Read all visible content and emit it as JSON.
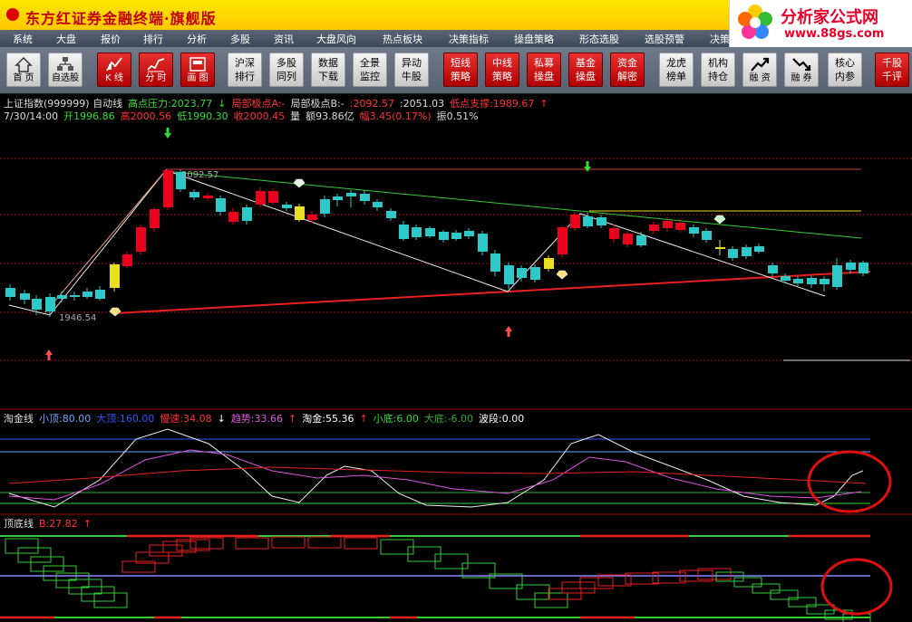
{
  "app": {
    "title": "东方红证券金融终端·旗舰版",
    "brand_name": "分析家公式网",
    "brand_url": "www.88gs.com"
  },
  "menu": [
    "系统",
    "大盘",
    "报价",
    "排行",
    "分析",
    "多股",
    "资讯",
    "大盘风向",
    "热点板块",
    "决策指标",
    "操盘策略",
    "形态选股",
    "选股预警",
    "决策"
  ],
  "toolbar": [
    {
      "label": "首 页",
      "style": "grey",
      "icon": "home-icon"
    },
    {
      "label": "自选股",
      "style": "grey",
      "icon": "portfolio-icon"
    },
    {
      "label": "K 线",
      "style": "red",
      "icon": "kline-icon"
    },
    {
      "label": "分 时",
      "style": "red",
      "icon": "timeshare-icon"
    },
    {
      "label": "画 图",
      "style": "red",
      "icon": "draw-icon"
    },
    {
      "label": "沪深\n排行",
      "style": "grey"
    },
    {
      "label": "多股\n同列",
      "style": "grey"
    },
    {
      "label": "数据\n下载",
      "style": "grey"
    },
    {
      "label": "全景\n监控",
      "style": "grey"
    },
    {
      "label": "异动\n牛股",
      "style": "grey"
    },
    {
      "label": "短线\n策略",
      "style": "red"
    },
    {
      "label": "中线\n策略",
      "style": "red"
    },
    {
      "label": "私募\n操盘",
      "style": "red"
    },
    {
      "label": "基金\n操盘",
      "style": "red"
    },
    {
      "label": "资金\n解密",
      "style": "red"
    },
    {
      "label": "龙虎\n榜单",
      "style": "grey"
    },
    {
      "label": "机构\n持仓",
      "style": "grey"
    },
    {
      "label": "融 资",
      "style": "grey",
      "icon": "margin-up-icon"
    },
    {
      "label": "融 券",
      "style": "grey",
      "icon": "margin-down-icon"
    },
    {
      "label": "核心\n内参",
      "style": "grey"
    },
    {
      "label": "千股\n千评",
      "style": "red"
    }
  ],
  "main_info": {
    "line1": [
      {
        "text": "上证指数(999999) 自动线",
        "color": "#dddddd"
      },
      {
        "text": "高点压力:2023.77",
        "color": "#33dd33"
      },
      {
        "text": "↓",
        "color": "#33dd33"
      },
      {
        "text": "局部极点A:-",
        "color": "#ff3333"
      },
      {
        "text": "局部极点B:-",
        "color": "#dddddd"
      },
      {
        "text": ":2092.57",
        "color": "#ff3333"
      },
      {
        "text": ":2051.03",
        "color": "#dddddd"
      },
      {
        "text": "低点支撑:1989.67",
        "color": "#ff3333"
      },
      {
        "text": "↑",
        "color": "#ff3333"
      }
    ],
    "line2": [
      {
        "text": "7/30/14:00",
        "color": "#dddddd"
      },
      {
        "text": "开1996.86",
        "color": "#33dd33"
      },
      {
        "text": "高2000.56",
        "color": "#ff3333"
      },
      {
        "text": "低1990.30",
        "color": "#33dd33"
      },
      {
        "text": "收2000.45",
        "color": "#ff3333"
      },
      {
        "text": "量",
        "color": "#dddddd"
      },
      {
        "text": "额93.86亿",
        "color": "#dddddd"
      },
      {
        "text": "幅3.45(0.17%)",
        "color": "#ff3333"
      },
      {
        "text": "振0.51%",
        "color": "#dddddd"
      }
    ]
  },
  "price_labels": {
    "high": "2092.57",
    "low": "1946.54"
  },
  "ind1_info": [
    {
      "text": "淘金线",
      "color": "#dddddd"
    },
    {
      "text": "小顶:80.00",
      "color": "#6aa8ff"
    },
    {
      "text": "大顶:160.00",
      "color": "#3355ff"
    },
    {
      "text": "慢速:34.08",
      "color": "#ff3333"
    },
    {
      "text": "↓",
      "color": "#ffffff"
    },
    {
      "text": "趋势:33.66",
      "color": "#dd55dd"
    },
    {
      "text": "↑",
      "color": "#ff3333"
    },
    {
      "text": "淘金:55.36",
      "color": "#ffffff"
    },
    {
      "text": "↑",
      "color": "#ff3333"
    },
    {
      "text": "小底:6.00",
      "color": "#33dd33"
    },
    {
      "text": "大底:-6.00",
      "color": "#33aa33"
    },
    {
      "text": "波段:0.00",
      "color": "#ffffff"
    }
  ],
  "ind2_info": [
    {
      "text": "顶底线",
      "color": "#dddddd"
    },
    {
      "text": "B:27.82",
      "color": "#ff3333"
    },
    {
      "text": "↑",
      "color": "#ff3333"
    }
  ],
  "colors": {
    "up": "#e8001c",
    "down": "#2dc8c8",
    "yellow": "#e8e020",
    "grid": "#8b1a1a"
  }
}
